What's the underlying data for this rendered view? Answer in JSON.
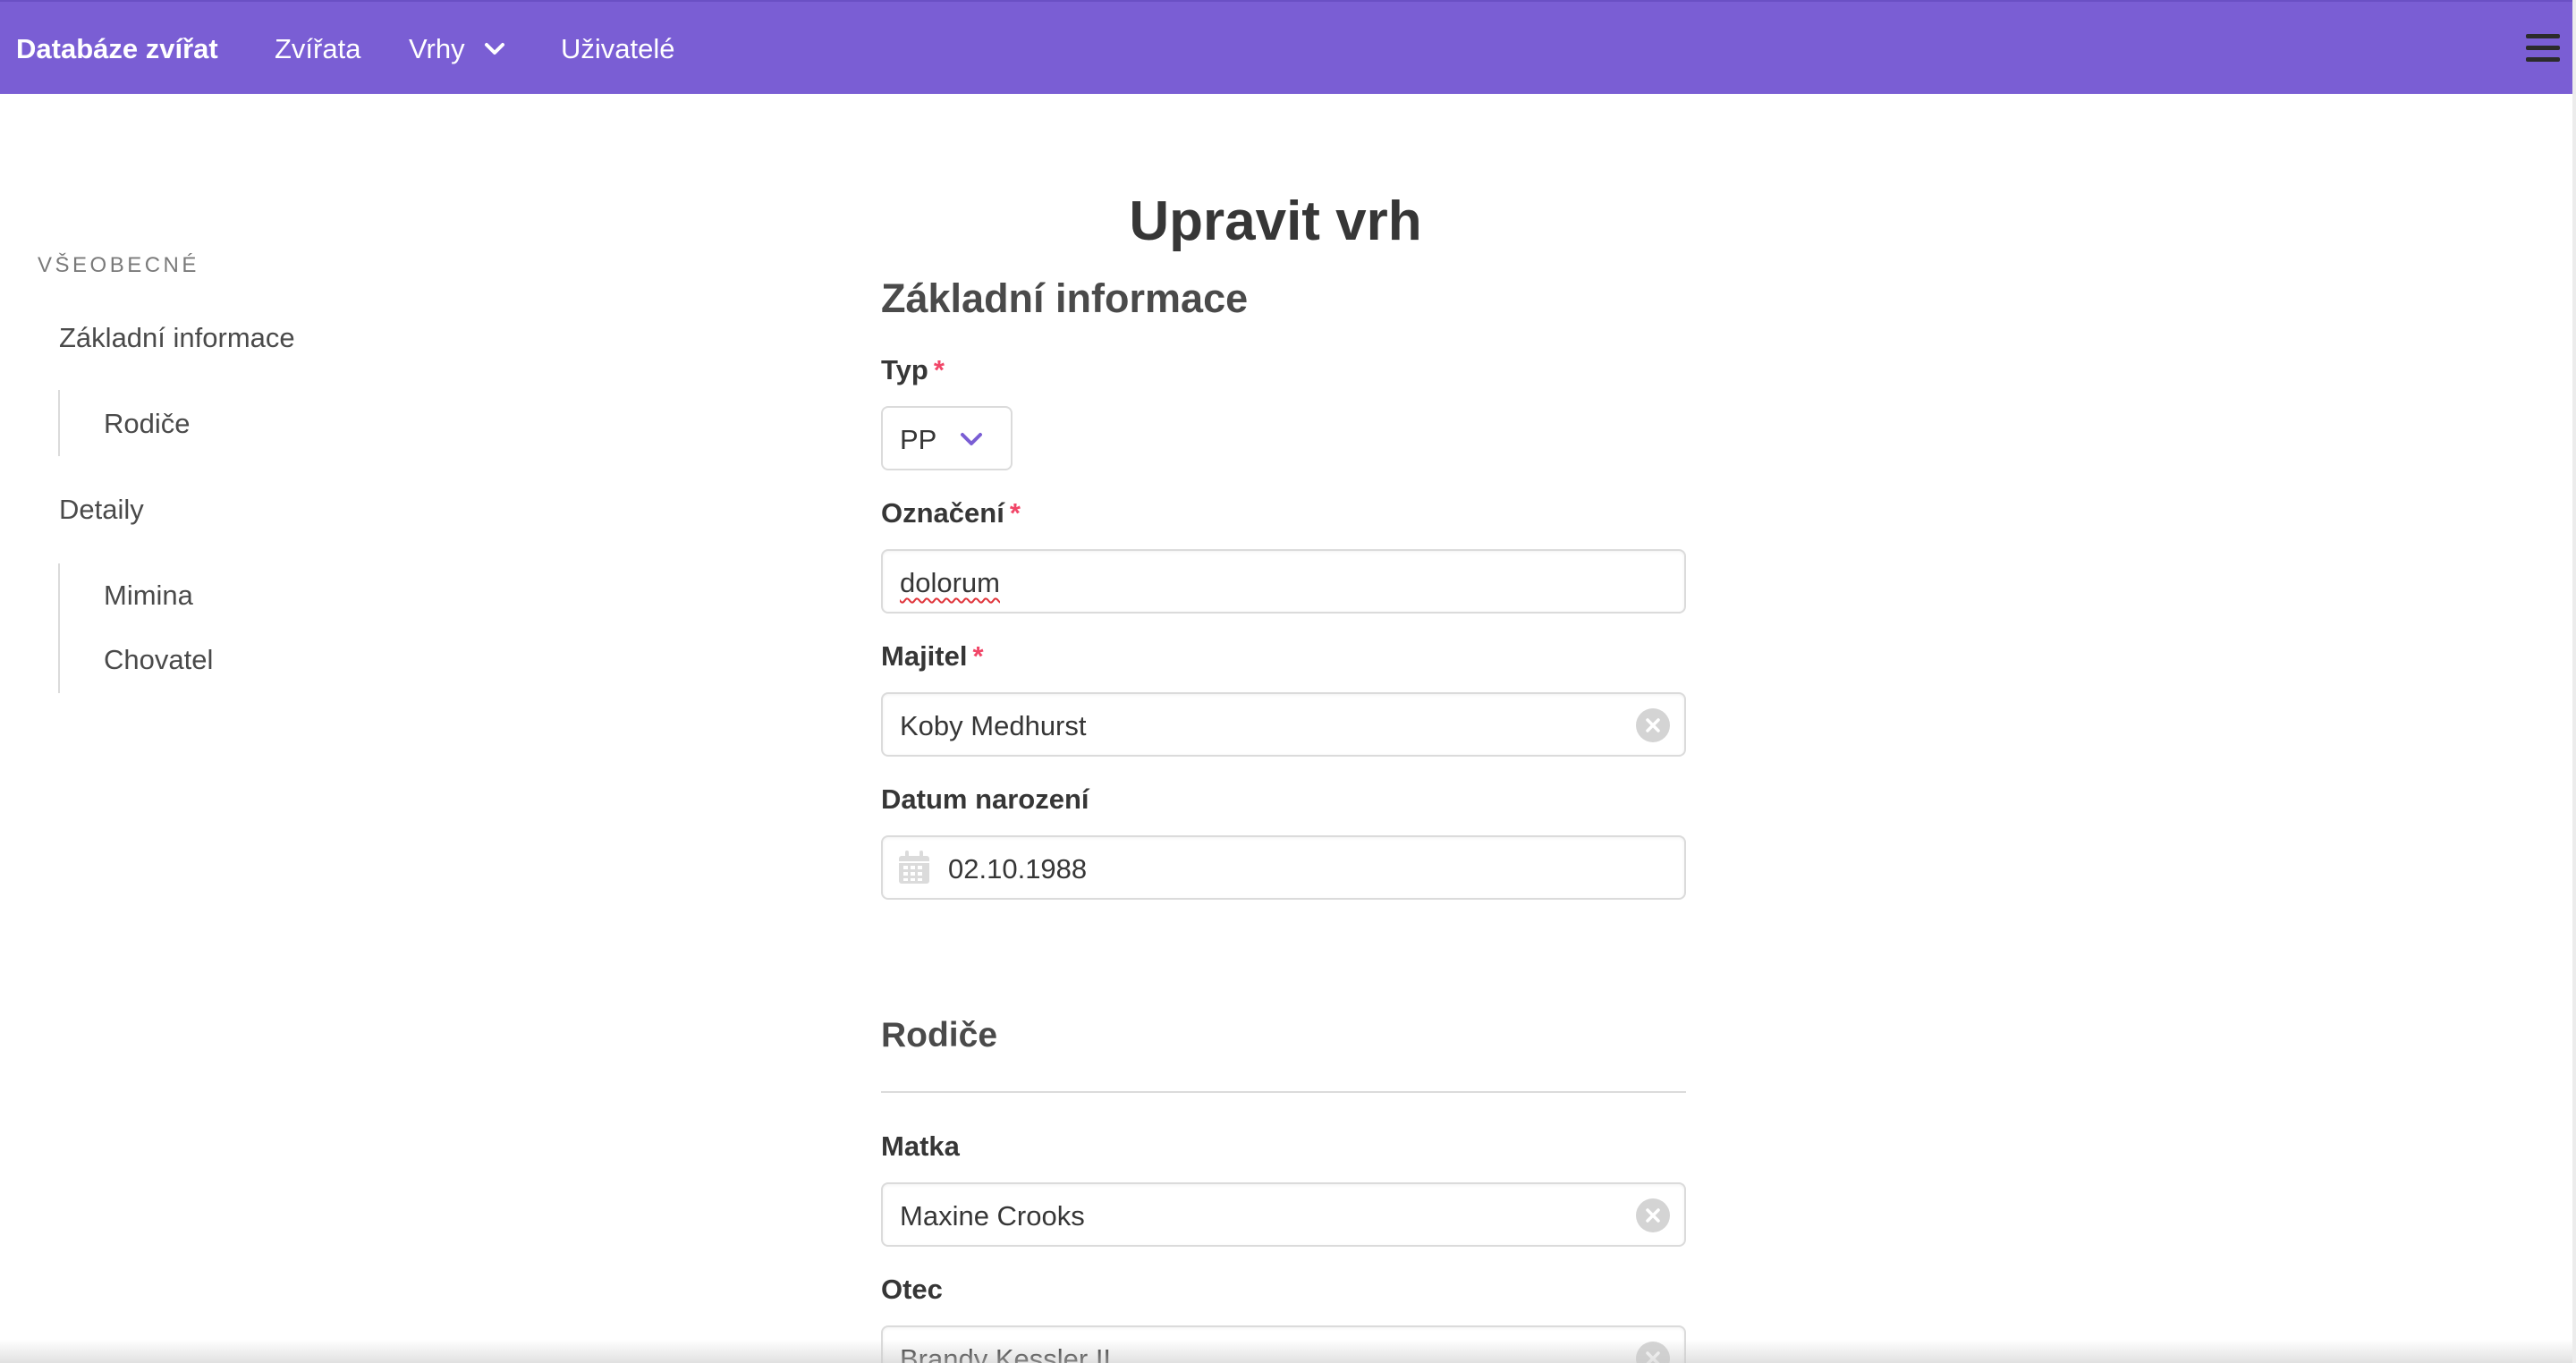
{
  "navbar": {
    "brand": "Databáze zvířat",
    "items": [
      {
        "label": "Zvířata"
      },
      {
        "label": "Vrhy",
        "icon": "chevron-down-icon"
      },
      {
        "label": "Uživatelé"
      }
    ],
    "menu_icon": "hamburger-menu-icon",
    "color": "#7a5ed4"
  },
  "sidebar": {
    "section_label": "Všeobecné",
    "items": [
      {
        "label": "Základní informace"
      },
      {
        "label": "Rodiče"
      },
      {
        "label": "Detaily"
      },
      {
        "label": "Mimina"
      },
      {
        "label": "Chovatel"
      }
    ]
  },
  "form": {
    "title": "Upravit vrh",
    "section_basic": "Základní informace",
    "typ": {
      "label": "Typ",
      "required": "*",
      "value": "PP"
    },
    "oznaceni": {
      "label": "Označení",
      "required": "*",
      "value": "dolorum"
    },
    "majitel": {
      "label": "Majitel",
      "required": "*",
      "value": "Koby Medhurst"
    },
    "datum": {
      "label": "Datum narození",
      "value": "02.10.1988",
      "icon": "calendar-icon"
    },
    "section_parents": "Rodiče",
    "matka": {
      "label": "Matka",
      "value": "Maxine Crooks"
    },
    "otec": {
      "label": "Otec",
      "value": "Brandy Kessler II"
    }
  }
}
